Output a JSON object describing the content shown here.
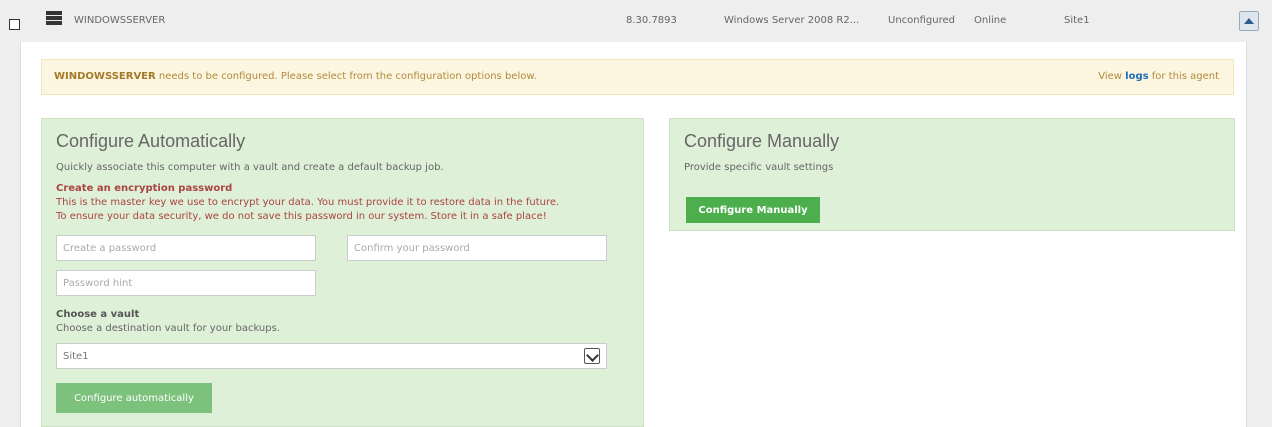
{
  "agent_row": {
    "name": "WINDOWSSERVER",
    "version": "8.30.7893",
    "os": "Windows Server 2008 R2...",
    "config_status": "Unconfigured",
    "online_status": "Online",
    "site": "Site1",
    "icons": {
      "checkbox": "checkbox-icon",
      "server": "server-icon",
      "collapse": "chevron-up-icon"
    }
  },
  "notice": {
    "agent_name": "WINDOWSSERVER",
    "message": " needs to be configured. Please select from the configuration options below.",
    "view_prefix": "View ",
    "logs_link": "logs",
    "view_suffix": " for this agent"
  },
  "auto": {
    "title": "Configure Automatically",
    "description": "Quickly associate this computer with a vault and create a default backup job.",
    "warning_title": "Create an encryption password",
    "warning_line1": "This is the master key we use to encrypt your data. You must provide it to restore data in the future.",
    "warning_line2": "To ensure your data security, we do not save this password in our system. Store it in a safe place!",
    "password_placeholder": "Create a password",
    "confirm_placeholder": "Confirm your password",
    "hint_placeholder": "Password hint",
    "vault_title": "Choose a vault",
    "vault_description": "Choose a destination vault for your backups.",
    "vault_selected": "Site1",
    "button_label": "Configure automatically"
  },
  "manual": {
    "title": "Configure Manually",
    "description": "Provide specific vault settings",
    "button_label": "Configure Manually"
  },
  "colors": {
    "box_bg": "#dff0d8",
    "warning_text": "#a94442",
    "notice_bg": "#fcf6e1",
    "button_green": "#4cae4c",
    "link": "#1e6bb8"
  }
}
